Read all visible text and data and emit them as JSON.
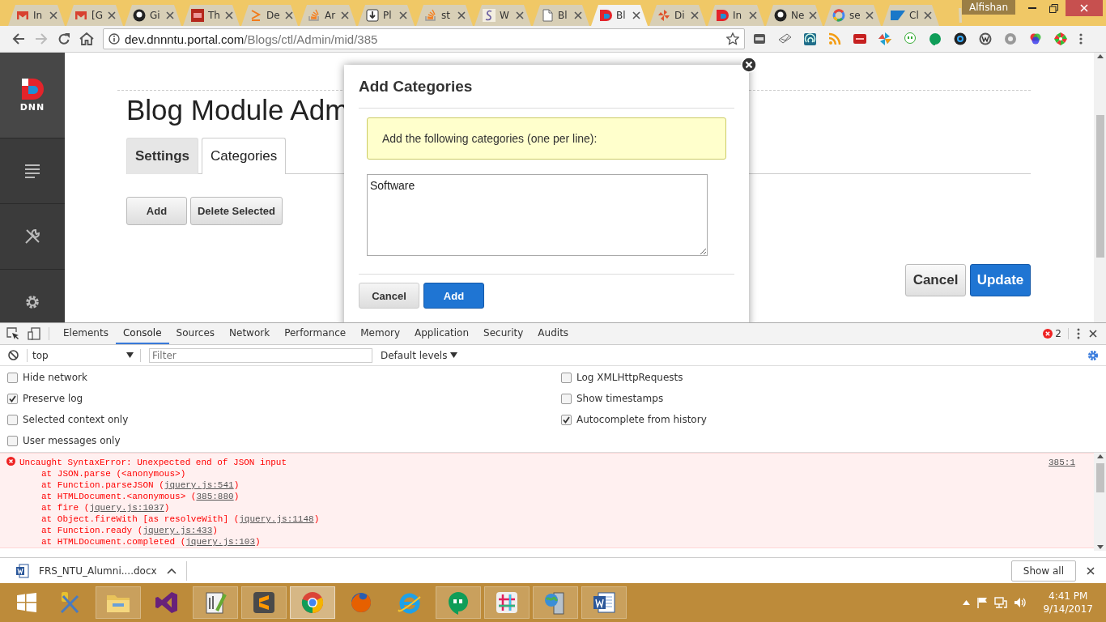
{
  "browser_tabs": [
    {
      "title": "In",
      "kind": "mail",
      "selected": false
    },
    {
      "title": "[G",
      "kind": "mail",
      "selected": false
    },
    {
      "title": "Gi",
      "kind": "round",
      "selected": false
    },
    {
      "title": "Th",
      "kind": "square",
      "selected": false
    },
    {
      "title": "De",
      "kind": "chevron",
      "selected": false
    },
    {
      "title": "Ar",
      "kind": "stack",
      "selected": false
    },
    {
      "title": "Pl",
      "kind": "download",
      "selected": false
    },
    {
      "title": "st",
      "kind": "stack",
      "selected": false
    },
    {
      "title": "W",
      "kind": "curve",
      "selected": false
    },
    {
      "title": "Bl",
      "kind": "page",
      "selected": false
    },
    {
      "title": "Bl",
      "kind": "split",
      "selected": true
    },
    {
      "title": "Di",
      "kind": "pinwheel",
      "selected": false
    },
    {
      "title": "In",
      "kind": "split",
      "selected": false
    },
    {
      "title": "Ne",
      "kind": "round",
      "selected": false
    },
    {
      "title": "se",
      "kind": "ring",
      "selected": false
    },
    {
      "title": "Cl",
      "kind": "flag",
      "selected": false
    }
  ],
  "profile": {
    "name": "Alfishan"
  },
  "address_bar": {
    "host": "dev.dnnntu.portal.com",
    "path": "/Blogs/ctl/Admin/mid/385"
  },
  "sidebar": {
    "logo_text": "DNN"
  },
  "page": {
    "title": "Blog Module Adm",
    "tabs": [
      {
        "label": "Settings",
        "selected": false
      },
      {
        "label": "Categories",
        "selected": true
      }
    ],
    "buttons": [
      "Add",
      "Delete Selected"
    ],
    "footer_buttons": [
      {
        "label": "Cancel",
        "kind": "secondary"
      },
      {
        "label": "Update",
        "kind": "primary"
      }
    ]
  },
  "dialog": {
    "title": "Add Categories",
    "notice": "Add the following categories (one per line):",
    "value": "Software",
    "buttons": [
      {
        "label": "Cancel",
        "kind": "secondary"
      },
      {
        "label": "Add",
        "kind": "primary"
      }
    ]
  },
  "devtools": {
    "tabs": [
      {
        "label": "Elements",
        "selected": false
      },
      {
        "label": "Console",
        "selected": true
      },
      {
        "label": "Sources",
        "selected": false
      },
      {
        "label": "Network",
        "selected": false
      },
      {
        "label": "Performance",
        "selected": false
      },
      {
        "label": "Memory",
        "selected": false
      },
      {
        "label": "Application",
        "selected": false
      },
      {
        "label": "Security",
        "selected": false
      },
      {
        "label": "Audits",
        "selected": false
      }
    ],
    "error_count": "2",
    "context": "top",
    "filter_placeholder": "Filter",
    "levels": "Default levels",
    "options_left": [
      {
        "label": "Hide network",
        "checked": false
      },
      {
        "label": "Preserve log",
        "checked": true
      },
      {
        "label": "Selected context only",
        "checked": false
      },
      {
        "label": "User messages only",
        "checked": false
      }
    ],
    "options_right": [
      {
        "label": "Log XMLHttpRequests",
        "checked": false
      },
      {
        "label": "Show timestamps",
        "checked": false
      },
      {
        "label": "Autocomplete from history",
        "checked": true
      }
    ],
    "error": {
      "message": "Uncaught SyntaxError: Unexpected end of JSON input",
      "source": "385:1",
      "stack": [
        {
          "text": "at JSON.parse (<anonymous>)"
        },
        {
          "text": "at Function.parseJSON (",
          "link": "jquery.js:541",
          "after": ")"
        },
        {
          "text": "at HTMLDocument.<anonymous> (",
          "link": "385:880",
          "after": ")"
        },
        {
          "text": "at fire (",
          "link": "jquery.js:1037",
          "after": ")"
        },
        {
          "text": "at Object.fireWith [as resolveWith] (",
          "link": "jquery.js:1148",
          "after": ")"
        },
        {
          "text": "at Function.ready (",
          "link": "jquery.js:433",
          "after": ")"
        },
        {
          "text": "at HTMLDocument.completed (",
          "link": "jquery.js:103",
          "after": ")"
        }
      ]
    }
  },
  "download_bar": {
    "file": "FRS_NTU_Alumni....docx",
    "show_all": "Show all"
  },
  "taskbar": {
    "apps": [
      {
        "kind": "tools",
        "running": false,
        "selected": false
      },
      {
        "kind": "folder",
        "running": true,
        "selected": false
      },
      {
        "kind": "studio",
        "running": false,
        "selected": false
      },
      {
        "kind": "notepad",
        "running": true,
        "selected": false
      },
      {
        "kind": "sublime",
        "running": true,
        "selected": false
      },
      {
        "kind": "chrome",
        "running": true,
        "selected": true
      },
      {
        "kind": "firefox",
        "running": false,
        "selected": false
      },
      {
        "kind": "ie",
        "running": false,
        "selected": false
      },
      {
        "kind": "hangouts",
        "running": true,
        "selected": false
      },
      {
        "kind": "slack",
        "running": true,
        "selected": false
      },
      {
        "kind": "server",
        "running": true,
        "selected": false
      },
      {
        "kind": "word",
        "running": true,
        "selected": false
      }
    ],
    "time": "4:41 PM",
    "date": "9/14/2017"
  }
}
